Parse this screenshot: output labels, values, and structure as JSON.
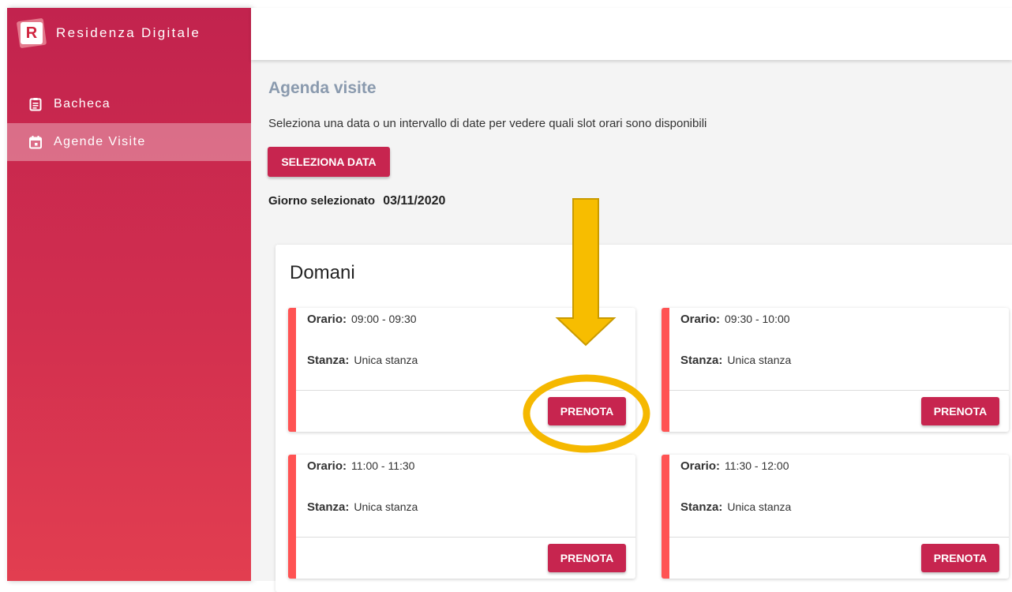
{
  "app": {
    "name": "Residenza Digitale",
    "logo_letter": "R"
  },
  "sidebar": {
    "items": [
      {
        "label": "Bacheca",
        "icon": "clipboard-icon",
        "active": false
      },
      {
        "label": "Agende Visite",
        "icon": "calendar-icon",
        "active": true
      }
    ]
  },
  "main": {
    "title": "Agenda visite",
    "description": "Seleziona una data o un intervallo di date per vedere quali slot orari sono disponibili",
    "select_date_label": "SELEZIONA DATA",
    "selected_day_label": "Giorno selezionato",
    "selected_day_value": "03/11/2020"
  },
  "agenda": {
    "title": "Domani",
    "orario_label": "Orario:",
    "stanza_label": "Stanza:",
    "book_label": "PRENOTA",
    "slots": [
      {
        "orario": "09:00 - 09:30",
        "stanza": "Unica stanza"
      },
      {
        "orario": "09:30 - 10:00",
        "stanza": "Unica stanza"
      },
      {
        "orario": "11:00 - 11:30",
        "stanza": "Unica stanza"
      },
      {
        "orario": "11:30 - 12:00",
        "stanza": "Unica stanza"
      }
    ]
  },
  "colors": {
    "primary": "#c7254f",
    "slot_accent": "#ff5353",
    "highlight": "#f5b800"
  }
}
